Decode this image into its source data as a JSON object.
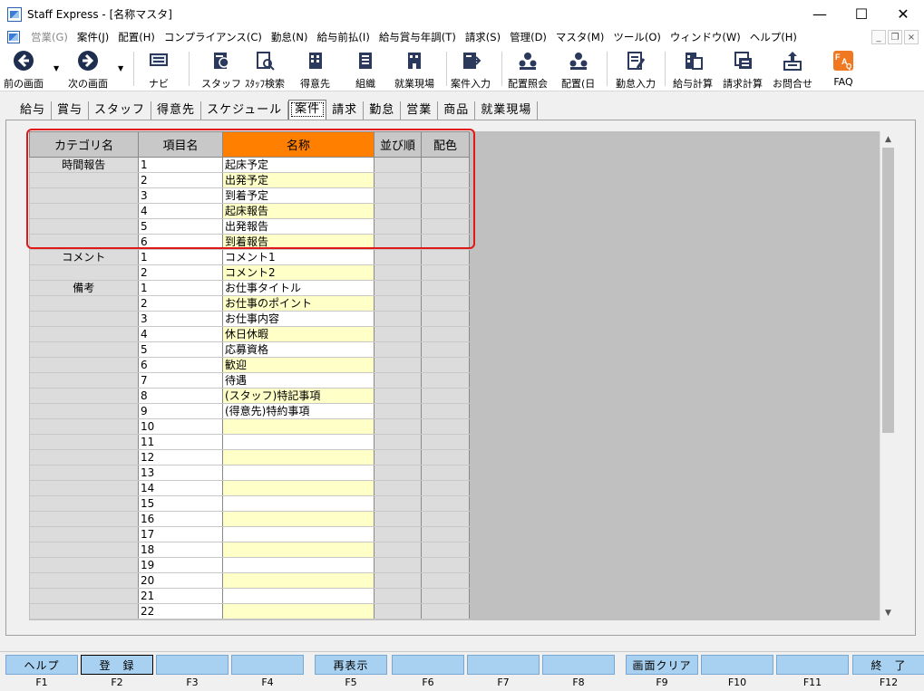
{
  "window": {
    "title": "Staff Express - [名称マスタ]",
    "minimize": "—",
    "maximize": "☐",
    "close": "✕"
  },
  "menu": [
    {
      "label": "営業(G)",
      "disabled": true
    },
    {
      "label": "案件(J)",
      "disabled": false
    },
    {
      "label": "配置(H)",
      "disabled": false
    },
    {
      "label": "コンプライアンス(C)",
      "disabled": false
    },
    {
      "label": "勤怠(N)",
      "disabled": false
    },
    {
      "label": "給与前払(I)",
      "disabled": false
    },
    {
      "label": "給与賞与年調(T)",
      "disabled": false
    },
    {
      "label": "請求(S)",
      "disabled": false
    },
    {
      "label": "管理(D)",
      "disabled": false
    },
    {
      "label": "マスタ(M)",
      "disabled": false
    },
    {
      "label": "ツール(O)",
      "disabled": false
    },
    {
      "label": "ウィンドウ(W)",
      "disabled": false
    },
    {
      "label": "ヘルプ(H)",
      "disabled": false
    }
  ],
  "mdi": {
    "minimize": "_",
    "restore": "❐",
    "close": "×"
  },
  "toolbar": [
    {
      "label": "前の画面",
      "icon": "back-arrow-icon"
    },
    {
      "label": "次の画面",
      "icon": "forward-arrow-icon"
    },
    {
      "label": "ナビ",
      "icon": "navi-icon"
    },
    {
      "label": "スタッフ",
      "icon": "staff-icon"
    },
    {
      "label": "ｽﾀｯﾌ検索",
      "icon": "staff-search-icon"
    },
    {
      "label": "得意先",
      "icon": "client-icon"
    },
    {
      "label": "組織",
      "icon": "organization-icon"
    },
    {
      "label": "就業現場",
      "icon": "worksite-icon"
    },
    {
      "label": "案件入力",
      "icon": "case-input-icon"
    },
    {
      "label": "配置照会",
      "icon": "placement-query-icon"
    },
    {
      "label": "配置(日",
      "icon": "placement-daily-icon"
    },
    {
      "label": "勤怠入力",
      "icon": "attendance-input-icon"
    },
    {
      "label": "給与計算",
      "icon": "payroll-icon"
    },
    {
      "label": "請求計算",
      "icon": "billing-icon"
    },
    {
      "label": "お問合せ",
      "icon": "inquiry-icon"
    },
    {
      "label": "FAQ",
      "icon": "faq-icon"
    }
  ],
  "tabs": [
    "給与",
    "賞与",
    "スタッフ",
    "得意先",
    "スケジュール",
    "案件",
    "請求",
    "勤怠",
    "営業",
    "商品",
    "就業現場"
  ],
  "active_tab": "案件",
  "grid": {
    "headers": [
      "カテゴリ名",
      "項目名",
      "名称",
      "並び順",
      "配色"
    ],
    "groups": [
      {
        "category": "時間報告",
        "rows": [
          {
            "no": "1",
            "name": "起床予定"
          },
          {
            "no": "2",
            "name": "出発予定"
          },
          {
            "no": "3",
            "name": "到着予定"
          },
          {
            "no": "4",
            "name": "起床報告"
          },
          {
            "no": "5",
            "name": "出発報告"
          },
          {
            "no": "6",
            "name": "到着報告"
          }
        ]
      },
      {
        "category": "コメント",
        "rows": [
          {
            "no": "1",
            "name": "コメント1"
          },
          {
            "no": "2",
            "name": "コメント2"
          }
        ]
      },
      {
        "category": "備考",
        "rows": [
          {
            "no": "1",
            "name": "お仕事タイトル"
          },
          {
            "no": "2",
            "name": "お仕事のポイント"
          },
          {
            "no": "3",
            "name": "お仕事内容"
          },
          {
            "no": "4",
            "name": "休日休暇"
          },
          {
            "no": "5",
            "name": "応募資格"
          },
          {
            "no": "6",
            "name": "歓迎"
          },
          {
            "no": "7",
            "name": "待遇"
          },
          {
            "no": "8",
            "name": "(スタッフ)特記事項"
          },
          {
            "no": "9",
            "name": "(得意先)特約事項"
          },
          {
            "no": "10",
            "name": ""
          },
          {
            "no": "11",
            "name": ""
          },
          {
            "no": "12",
            "name": ""
          },
          {
            "no": "13",
            "name": ""
          },
          {
            "no": "14",
            "name": ""
          },
          {
            "no": "15",
            "name": ""
          },
          {
            "no": "16",
            "name": ""
          },
          {
            "no": "17",
            "name": ""
          },
          {
            "no": "18",
            "name": ""
          },
          {
            "no": "19",
            "name": ""
          },
          {
            "no": "20",
            "name": ""
          },
          {
            "no": "21",
            "name": ""
          },
          {
            "no": "22",
            "name": ""
          }
        ]
      }
    ]
  },
  "function_keys": [
    {
      "key": "F1",
      "label": "ヘルプ"
    },
    {
      "key": "F2",
      "label": "登　録"
    },
    {
      "key": "F3",
      "label": ""
    },
    {
      "key": "F4",
      "label": ""
    },
    {
      "key": "F5",
      "label": "再表示"
    },
    {
      "key": "F6",
      "label": ""
    },
    {
      "key": "F7",
      "label": ""
    },
    {
      "key": "F8",
      "label": ""
    },
    {
      "key": "F9",
      "label": "画面クリア"
    },
    {
      "key": "F10",
      "label": ""
    },
    {
      "key": "F11",
      "label": ""
    },
    {
      "key": "F12",
      "label": "終　了"
    }
  ],
  "colors": {
    "name_header": "#ff7f00",
    "highlight": "#e01818",
    "fkey": "#a8d0f0",
    "row_alt": "#ffffc8"
  }
}
